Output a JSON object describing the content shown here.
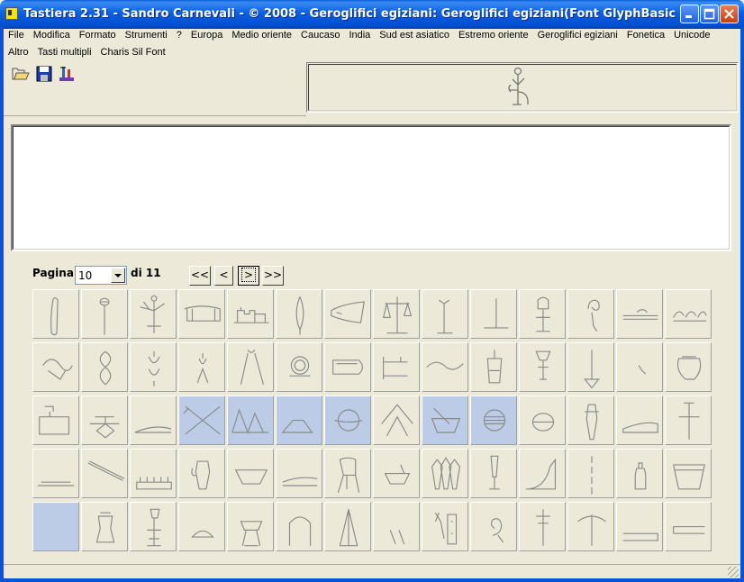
{
  "window": {
    "title": "Tastiera 2.31 - Sandro Carnevali - ©  2008 - Geroglifici egiziani: Geroglifici egiziani(Font GlyphBasic - Hint = Codi..."
  },
  "menu": {
    "row1": [
      "File",
      "Modifica",
      "Formato",
      "Strumenti",
      "?",
      "Europa",
      "Medio oriente",
      "Caucaso",
      "India",
      "Sud est asiatico",
      "Estremo oriente",
      "Geroglifici egiziani",
      "Fonetica",
      "Unicode"
    ],
    "row2": [
      "Altro",
      "Tasti multipli",
      "Charis Sil Font"
    ]
  },
  "toolbar": {
    "icons": [
      "open-folder-icon",
      "save-disk-icon",
      "font-tool-icon"
    ]
  },
  "preview": {
    "glyph": "seated-figure-hieroglyph"
  },
  "editor": {
    "text": ""
  },
  "pager": {
    "label": "Pagina",
    "current": "10",
    "of_label": "di 11",
    "buttons": [
      "<<",
      "<",
      ">",
      ">>"
    ]
  },
  "grid": {
    "rows": 5,
    "cols": 14,
    "selected": [
      31,
      32,
      33,
      34,
      36,
      37,
      56
    ],
    "glyphs": [
      "staff-loop",
      "mace",
      "figure-with-arms",
      "sledge",
      "shrine",
      "leaf",
      "horn-shape",
      "balance-scale",
      "stand",
      "corner",
      "vessel-on-stand",
      "curl",
      "papyrus-roll",
      "curls",
      "loop-rope",
      "figure-eight",
      "knot",
      "tie",
      "ribbon",
      "ring",
      "cartouche-shape",
      "hook-stick",
      "wave",
      "bag",
      "tripod-vase",
      "arrow-down",
      "slant",
      "jar",
      "table-offerings",
      "altar",
      "flat-hill",
      "crossed-sticks",
      "twin-hills",
      "sandal",
      "disk-loop",
      "chevron",
      "basket-stick",
      "striped-disk",
      "loaf",
      "tall-vase",
      "flat-slab",
      "cross",
      "ground-line",
      "stick",
      "comb",
      "jug",
      "bowl",
      "flat-boat",
      "bird-legs",
      "bowl-small",
      "triple-vases",
      "goblet",
      "mound",
      "dotted-line",
      "bottle",
      "basket",
      "empty",
      "vase",
      "standard",
      "half-disk",
      "pot-stand",
      "arch",
      "cone",
      "double-slash",
      "tools",
      "spiral",
      "post",
      "pick",
      "flat-bar",
      "double-bar"
    ]
  }
}
